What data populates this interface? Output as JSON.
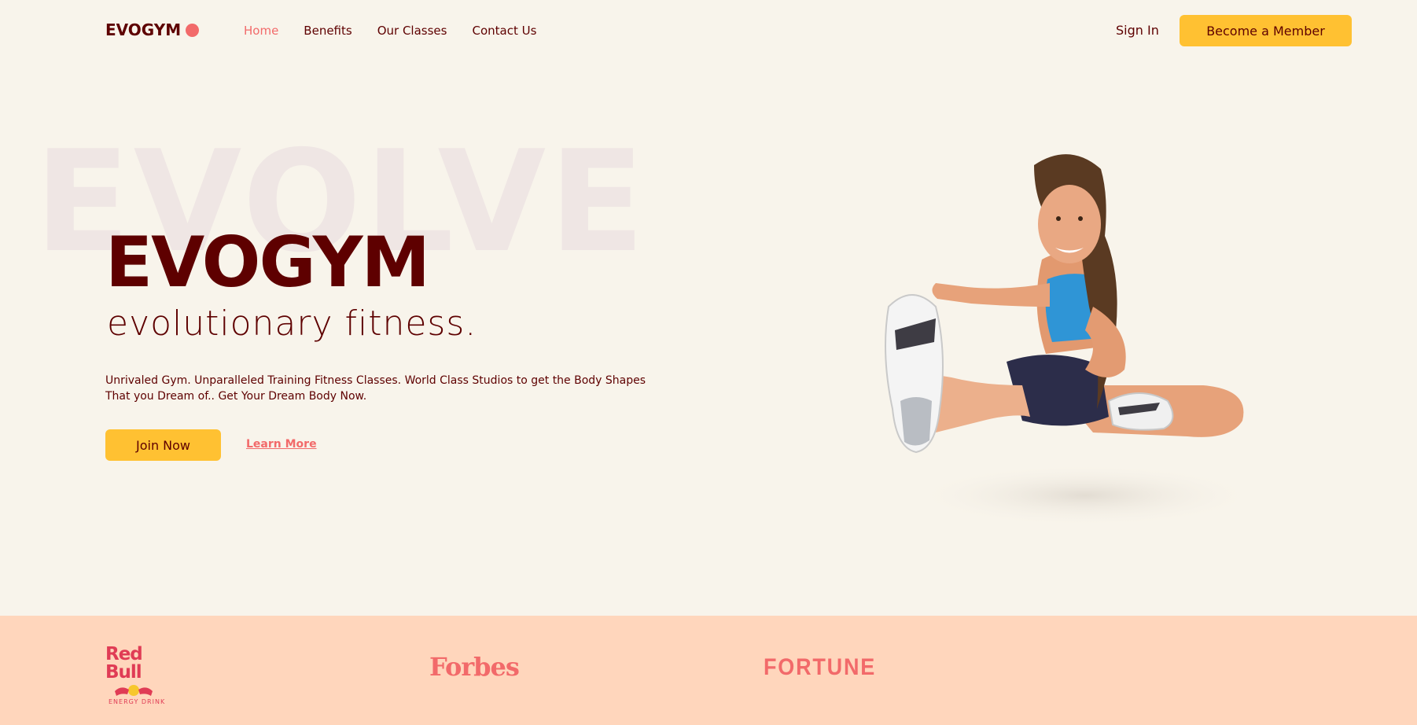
{
  "nav": {
    "logo": "EVOGYM",
    "links": [
      {
        "label": "Home",
        "active": true
      },
      {
        "label": "Benefits",
        "active": false
      },
      {
        "label": "Our Classes",
        "active": false
      },
      {
        "label": "Contact Us",
        "active": false
      }
    ],
    "sign_in": "Sign In",
    "member_button": "Become a Member"
  },
  "hero": {
    "background_word": "EVOLVE",
    "title": "EVOGYM",
    "subtitle": "evolutionary fitness.",
    "description": "Unrivaled Gym. Unparalleled Training Fitness Classes. World Class Studios to get the Body Shapes That you Dream of.. Get Your Dream Body Now.",
    "join_button": "Join Now",
    "learn_more": "Learn More"
  },
  "sponsors": {
    "redbull": {
      "name": "Red Bull",
      "sub": "ENERGY DRINK"
    },
    "forbes": "Forbes",
    "fortune": "FORTUNE"
  },
  "colors": {
    "background": "#f8f4eb",
    "primary_dark": "#5e0000",
    "accent_coral": "#f26a6a",
    "button_yellow": "#ffc132",
    "sponsor_band": "#ffd6bc"
  }
}
